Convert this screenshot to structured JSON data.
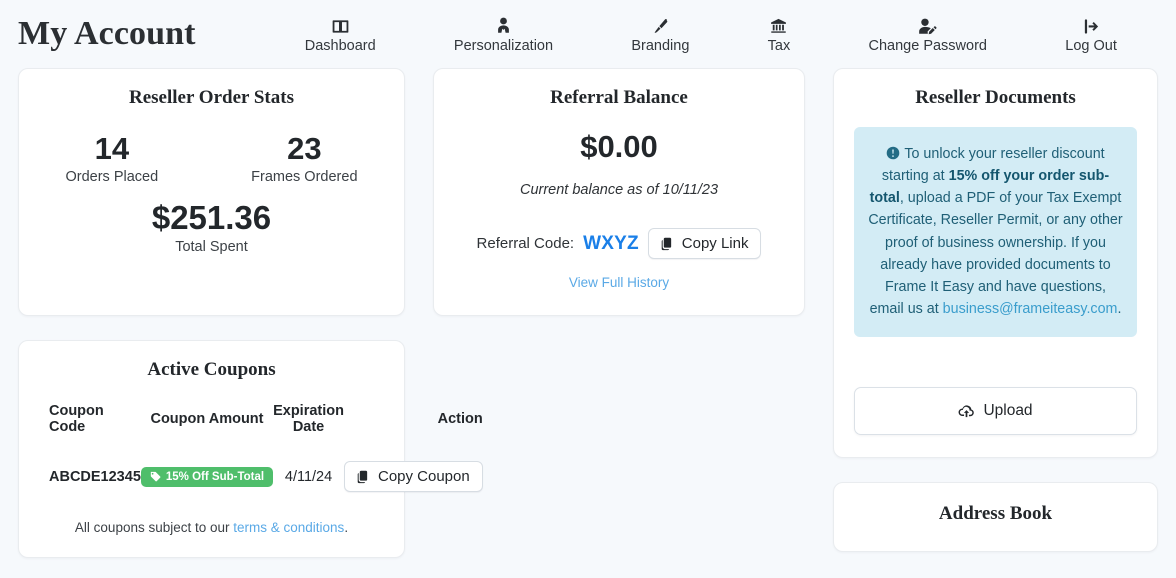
{
  "header": {
    "title": "My Account",
    "nav": [
      {
        "label": "Dashboard",
        "icon": "dashboard-icon"
      },
      {
        "label": "Personalization",
        "icon": "user-tie-icon"
      },
      {
        "label": "Branding",
        "icon": "paint-brush-icon"
      },
      {
        "label": "Tax",
        "icon": "bank-icon"
      },
      {
        "label": "Change Password",
        "icon": "user-edit-icon"
      },
      {
        "label": "Log Out",
        "icon": "sign-out-icon"
      }
    ]
  },
  "order_stats": {
    "title": "Reseller Order Stats",
    "orders_placed_value": "14",
    "orders_placed_label": "Orders Placed",
    "frames_ordered_value": "23",
    "frames_ordered_label": "Frames Ordered",
    "total_spent_value": "$251.36",
    "total_spent_label": "Total Spent"
  },
  "referral": {
    "title": "Referral Balance",
    "amount": "$0.00",
    "note": "Current balance as of 10/11/23",
    "code_label": "Referral Code:",
    "code": "WXYZ",
    "copy_link_label": "Copy Link",
    "history_link": "View Full History"
  },
  "coupons": {
    "title": "Active Coupons",
    "columns": [
      "Coupon Code",
      "Coupon Amount",
      "Expiration Date",
      "Action"
    ],
    "rows": [
      {
        "code": "ABCDE12345",
        "amount": "15% Off Sub-Total",
        "expiration": "4/11/24",
        "action_label": "Copy Coupon"
      }
    ],
    "footer_prefix": "All coupons subject to our ",
    "footer_link": "terms & conditions",
    "footer_suffix": "."
  },
  "documents": {
    "title": "Reseller Documents",
    "alert_part1": "To unlock your reseller discount starting at ",
    "alert_bold": "15% off your order sub-total",
    "alert_part2": ", upload a PDF of your Tax Exempt Certificate, Reseller Permit, or any other proof of business ownership. If you already have provided documents to Frame It Easy and have questions, email us at ",
    "alert_email": "business@frameiteasy.com",
    "alert_part3": ".",
    "upload_label": "Upload"
  },
  "address_book": {
    "title": "Address Book"
  },
  "colors": {
    "page_background": "#f6f9fc",
    "card_background": "#ffffff",
    "accent_blue": "#1a7fe8",
    "link_blue": "#5aa9e6",
    "badge_green": "#4fbe6b",
    "alert_background": "#d3ecf5",
    "alert_text": "#1f5f76"
  }
}
